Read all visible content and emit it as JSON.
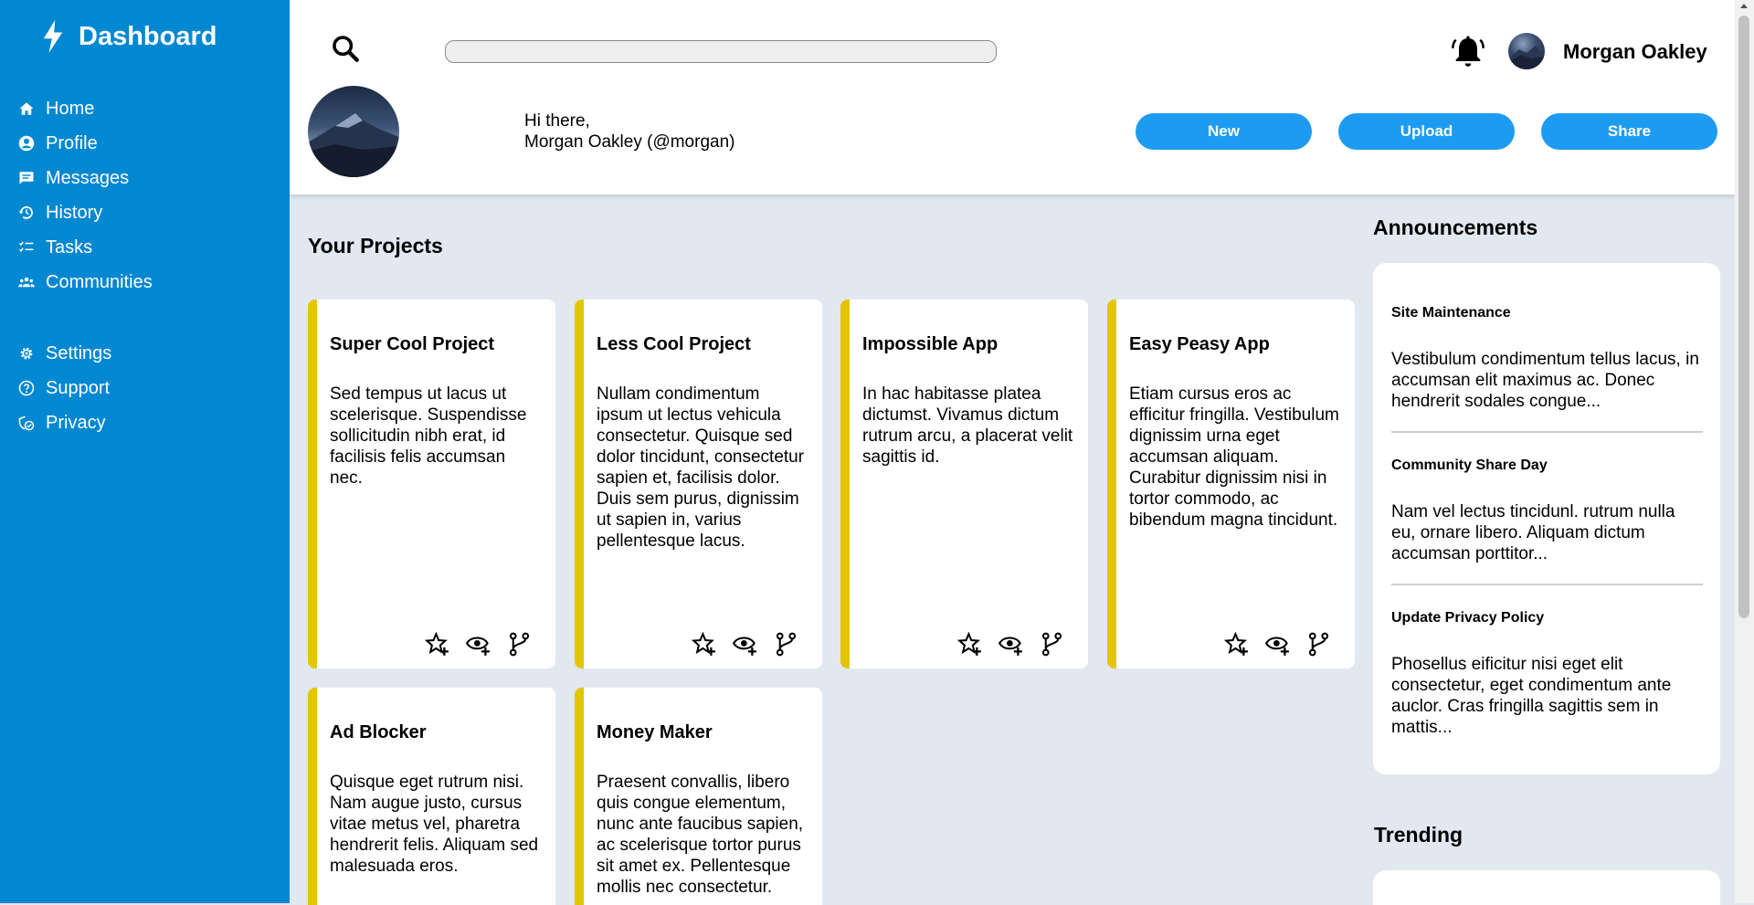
{
  "sidebar": {
    "brand": "Dashboard",
    "brand_icon": "lightning-bolt-icon",
    "main_items": [
      {
        "label": "Home",
        "icon": "home-icon"
      },
      {
        "label": "Profile",
        "icon": "account-circle-icon"
      },
      {
        "label": "Messages",
        "icon": "message-icon"
      },
      {
        "label": "History",
        "icon": "history-icon"
      },
      {
        "label": "Tasks",
        "icon": "task-list-icon"
      },
      {
        "label": "Communities",
        "icon": "people-group-icon"
      }
    ],
    "secondary_items": [
      {
        "label": "Settings",
        "icon": "gear-icon"
      },
      {
        "label": "Support",
        "icon": "help-circle-icon"
      },
      {
        "label": "Privacy",
        "icon": "shield-lock-icon"
      }
    ],
    "background": "#0288d1"
  },
  "header": {
    "search_placeholder": "",
    "username": "Morgan Oakley",
    "greeting_line1": "Hi there,",
    "greeting_line2": "Morgan Oakley (@morgan)",
    "buttons": {
      "new": "New",
      "upload": "Upload",
      "share": "Share"
    },
    "button_color": "#1d9bf0"
  },
  "projects": {
    "title": "Your Projects",
    "accent": "#e3c500",
    "items": [
      {
        "title": "Super Cool Project",
        "description": "Sed tempus ut lacus ut scelerisque. Suspendisse sollicitudin nibh erat, id facilisis felis accumsan nec."
      },
      {
        "title": "Less Cool Project",
        "description": "Nullam condimentum ipsum ut lectus vehicula consectetur. Quisque sed dolor tincidunt, consectetur sapien et, facilisis dolor. Duis sem purus, dignissim ut sapien in, varius pellentesque lacus."
      },
      {
        "title": "Impossible App",
        "description": "In hac habitasse platea dictumst. Vivamus dictum rutrum arcu, a placerat velit sagittis id."
      },
      {
        "title": "Easy Peasy App",
        "description": "Etiam cursus eros ac efficitur fringilla. Vestibulum dignissim urna eget accumsan aliquam. Curabitur dignissim nisi in tortor commodo, ac bibendum magna tincidunt."
      },
      {
        "title": "Ad Blocker",
        "description": "Quisque eget rutrum nisi. Nam augue justo, cursus vitae metus vel, pharetra hendrerit felis. Aliquam sed malesuada eros."
      },
      {
        "title": "Money Maker",
        "description": "Praesent convallis, libero quis congue elementum, nunc ante faucibus sapien, ac scelerisque tortor purus sit amet ex. Pellentesque mollis nec consectetur."
      }
    ]
  },
  "announcements": {
    "title": "Announcements",
    "items": [
      {
        "title": "Site Maintenance",
        "text": "Vestibulum condimentum tellus lacus, in accumsan elit maximus ac. Donec hendrerit sodales congue..."
      },
      {
        "title": "Community Share Day",
        "text": "Nam vel lectus tincidunl. rutrum nulla eu, ornare libero. Aliquam dictum accumsan porttitor..."
      },
      {
        "title": "Update Privacy Policy",
        "text": "Phosellus eificitur nisi eget elit consectetur, eget condimentum ante auclor. Cras fringilla sagittis sem in mattis..."
      }
    ]
  },
  "trending": {
    "title": "Trending"
  }
}
